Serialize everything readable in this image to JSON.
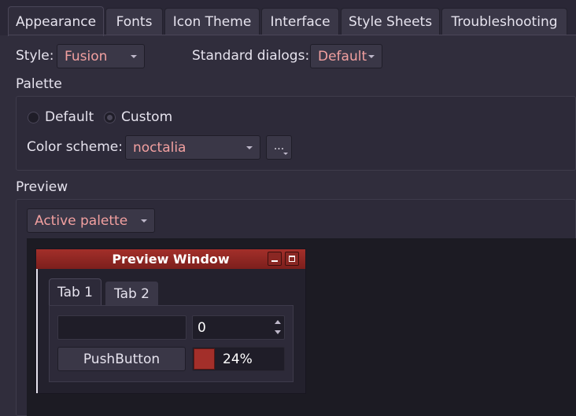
{
  "tabs": [
    "Appearance",
    "Fonts",
    "Icon Theme",
    "Interface",
    "Style Sheets",
    "Troubleshooting"
  ],
  "style": {
    "label": "Style:",
    "value": "Fusion"
  },
  "standard_dialogs": {
    "label": "Standard dialogs:",
    "value": "Default"
  },
  "palette": {
    "title": "Palette",
    "radio_default": "Default",
    "radio_custom": "Custom",
    "selected": "Custom",
    "color_scheme_label": "Color scheme:",
    "color_scheme_value": "noctalia",
    "more_button": "..."
  },
  "preview": {
    "title": "Preview",
    "palette_combo": "Active palette",
    "window_title": "Preview Window",
    "tabs": [
      "Tab 1",
      "Tab 2"
    ],
    "spin_value": "0",
    "push_button": "PushButton",
    "progress_text": "24%",
    "progress_value": 24
  },
  "colors": {
    "background": "#302d3c",
    "accent": "#a32f2a",
    "combo_text": "#f2a0a0"
  }
}
